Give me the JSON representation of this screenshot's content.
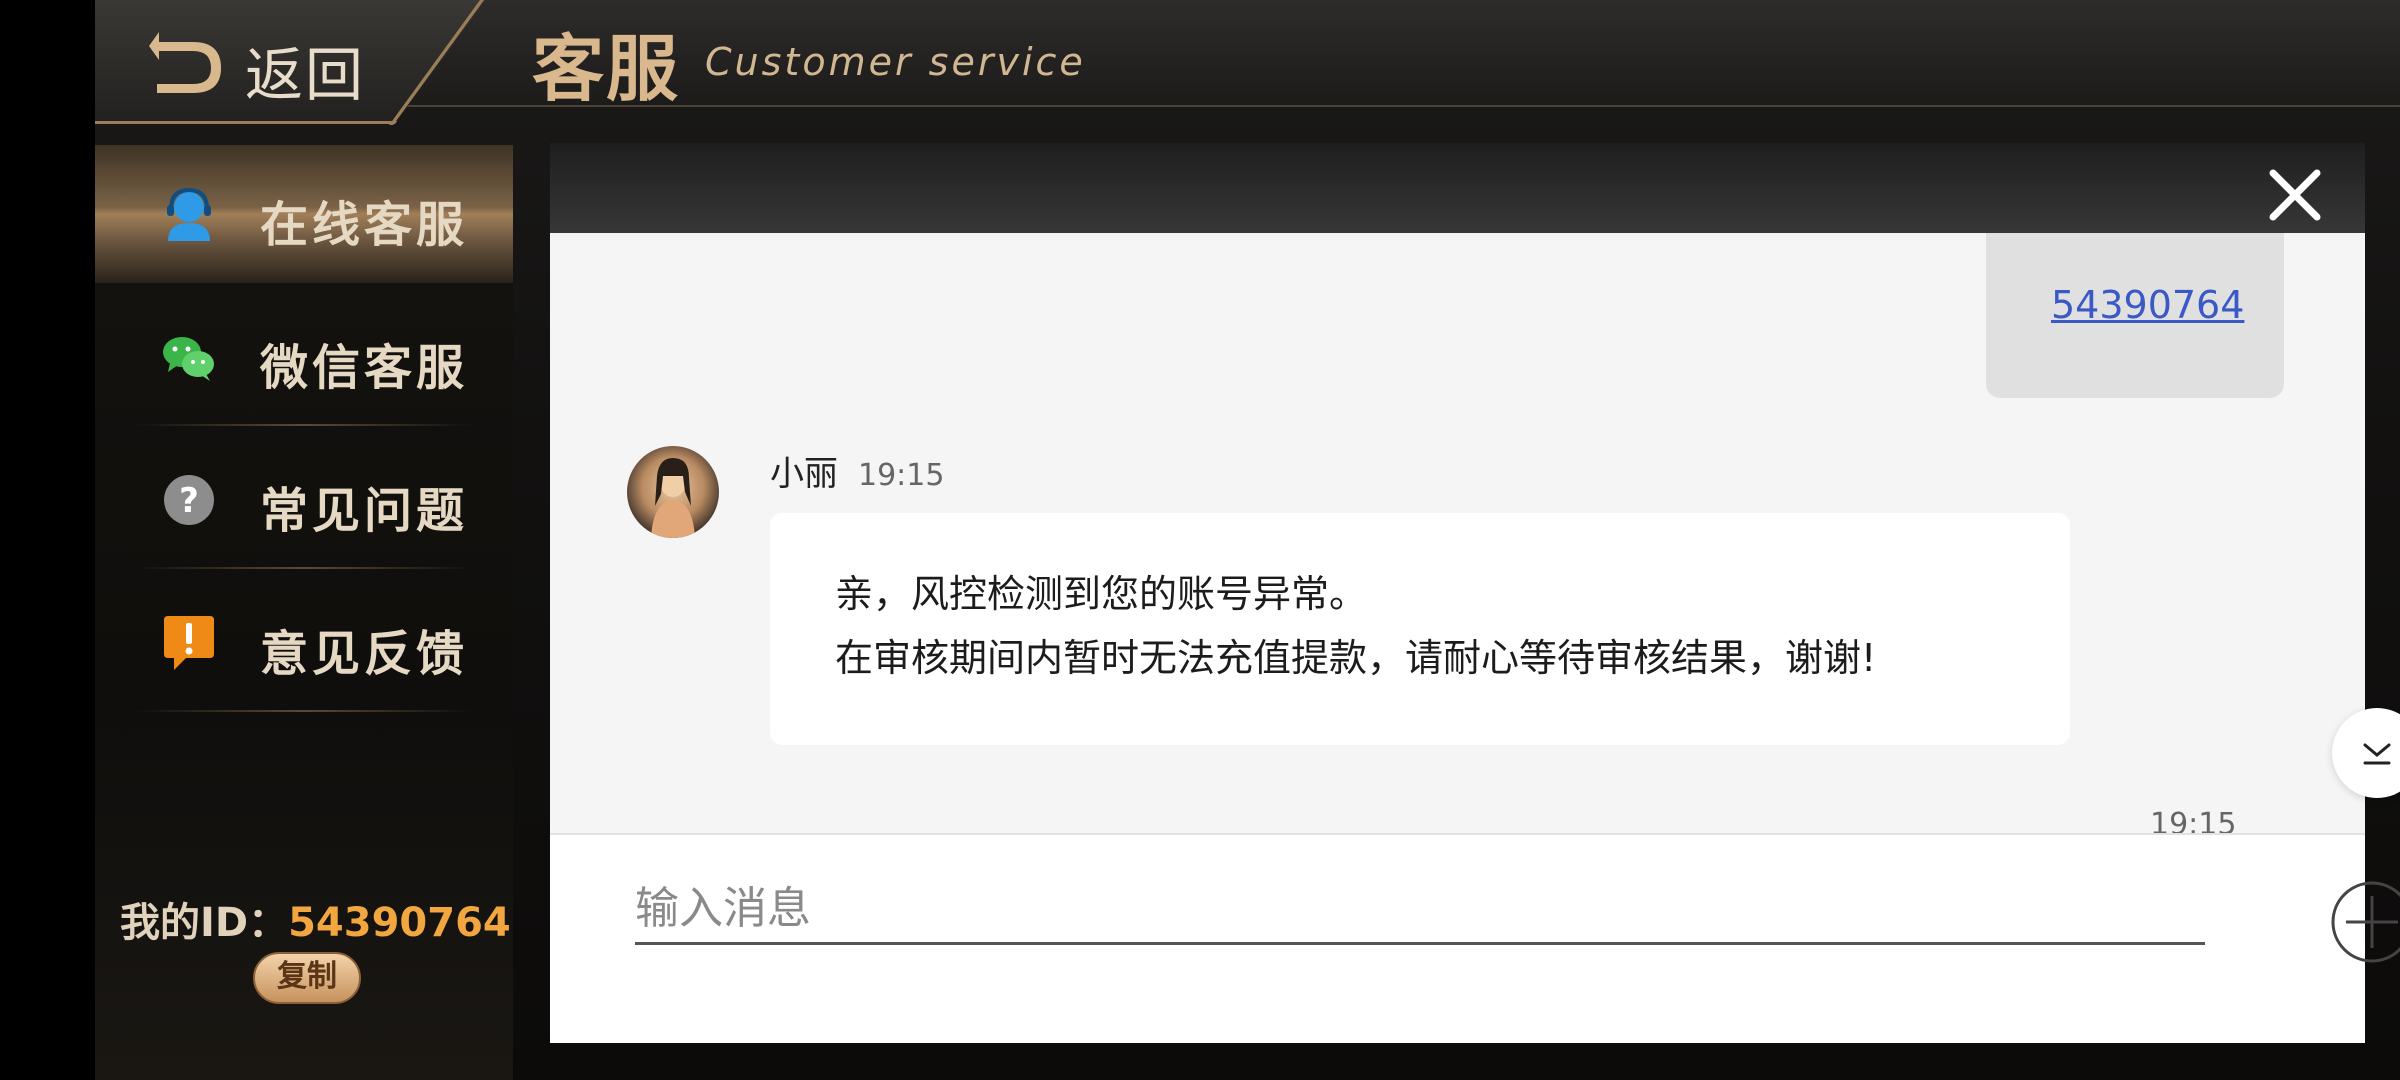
{
  "header": {
    "back_label": "返回",
    "title_cn": "客服",
    "title_en": "Customer service"
  },
  "sidebar": {
    "items": [
      {
        "label": "在线客服",
        "icon": "headset-user-icon",
        "active": true
      },
      {
        "label": "微信客服",
        "icon": "wechat-icon",
        "active": false
      },
      {
        "label": "常见问题",
        "icon": "question-icon",
        "active": false
      },
      {
        "label": "意见反馈",
        "icon": "feedback-exclamation-icon",
        "active": false
      }
    ],
    "my_id_label": "我的ID：",
    "my_id_value": "54390764",
    "copy_label": "复制"
  },
  "chat": {
    "self_message": "54390764",
    "agent": {
      "name": "小丽",
      "time": "19:15",
      "message_line1": "亲，风控检测到您的账号异常。",
      "message_line2": "在审核期间内暂时无法充值提款，请耐心等待审核结果，谢谢!"
    },
    "trailing_time": "19:15",
    "input_placeholder": "输入消息"
  },
  "colors": {
    "accent_gold": "#d9b88e",
    "id_orange": "#f2a640",
    "link_blue": "#3a58c6"
  }
}
